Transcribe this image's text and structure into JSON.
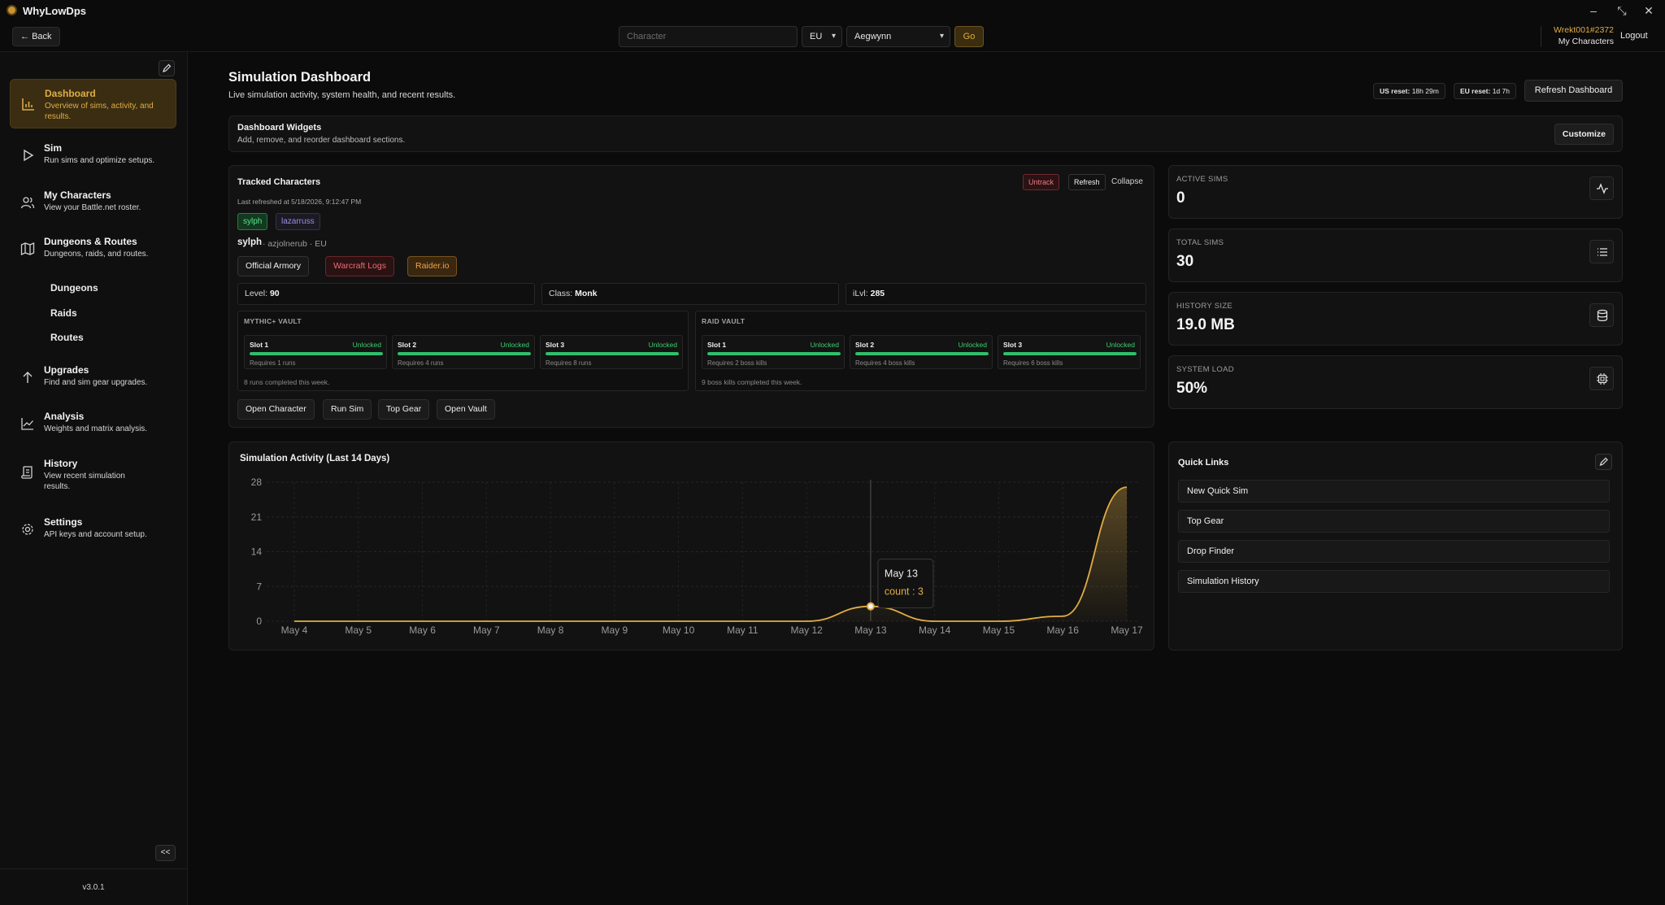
{
  "window": {
    "title": "WhyLowDps"
  },
  "header": {
    "back_label": "Back",
    "character_placeholder": "Character",
    "region": "EU",
    "realm": "Aegwynn",
    "go_label": "Go",
    "user_tag": "Wrekt001#2372",
    "my_characters_label": "My Characters",
    "logout_label": "Logout"
  },
  "sidebar": {
    "items": [
      {
        "title": "Dashboard",
        "desc": "Overview of sims, activity, and results.",
        "icon": "chart-bar-icon"
      },
      {
        "title": "Sim",
        "desc": "Run sims and optimize setups.",
        "icon": "play-icon"
      },
      {
        "title": "My Characters",
        "desc": "View your Battle.net roster.",
        "icon": "users-icon"
      },
      {
        "title": "Dungeons & Routes",
        "desc": "Dungeons, raids, and routes.",
        "icon": "map-icon"
      },
      {
        "title": "Upgrades",
        "desc": "Find and sim gear upgrades.",
        "icon": "arrow-up-icon"
      },
      {
        "title": "Analysis",
        "desc": "Weights and matrix analysis.",
        "icon": "trend-icon"
      },
      {
        "title": "History",
        "desc": "View recent simulation results.",
        "icon": "scroll-icon"
      },
      {
        "title": "Settings",
        "desc": "API keys and account setup.",
        "icon": "gear-icon"
      }
    ],
    "sub_items": [
      "Dungeons",
      "Raids",
      "Routes"
    ],
    "collapse_label": "<<",
    "version": "v3.0.1"
  },
  "page": {
    "title": "Simulation Dashboard",
    "subtitle": "Live simulation activity, system health, and recent results.",
    "us_reset_label": "US reset:",
    "us_reset_value": "18h 29m",
    "eu_reset_label": "EU reset:",
    "eu_reset_value": "1d 7h",
    "refresh_label": "Refresh Dashboard"
  },
  "widgets": {
    "title": "Dashboard Widgets",
    "subtitle": "Add, remove, and reorder dashboard sections.",
    "customize_label": "Customize"
  },
  "tracked": {
    "title": "Tracked Characters",
    "last_refreshed": "Last refreshed at 5/18/2026, 9:12:47 PM",
    "untrack_label": "Untrack",
    "refresh_label": "Refresh",
    "collapse_label": "Collapse",
    "chips": [
      "sylph",
      "lazarruss"
    ],
    "name": "sylph",
    "realm_region": "· azjolnerub · EU",
    "links": [
      "Official Armory",
      "Warcraft Logs",
      "Raider.io"
    ],
    "level_label": "Level:",
    "level": "90",
    "class_label": "Class:",
    "class": "Monk",
    "ilvl_label": "iLvl:",
    "ilvl": "285",
    "mythic_vault": {
      "title": "MYTHIC+ VAULT",
      "slots": [
        {
          "name": "Slot 1",
          "status": "Unlocked",
          "req": "Requires 1 runs",
          "progress": 1
        },
        {
          "name": "Slot 2",
          "status": "Unlocked",
          "req": "Requires 4 runs",
          "progress": 1
        },
        {
          "name": "Slot 3",
          "status": "Unlocked",
          "req": "Requires 8 runs",
          "progress": 1
        }
      ],
      "footer": "8 runs completed this week."
    },
    "raid_vault": {
      "title": "RAID VAULT",
      "slots": [
        {
          "name": "Slot 1",
          "status": "Unlocked",
          "req": "Requires 2 boss kills",
          "progress": 1
        },
        {
          "name": "Slot 2",
          "status": "Unlocked",
          "req": "Requires 4 boss kills",
          "progress": 1
        },
        {
          "name": "Slot 3",
          "status": "Unlocked",
          "req": "Requires 6 boss kills",
          "progress": 1
        }
      ],
      "footer": "9 boss kills completed this week."
    },
    "actions": [
      "Open Character",
      "Run Sim",
      "Top Gear",
      "Open Vault"
    ]
  },
  "stats": [
    {
      "label": "ACTIVE SIMS",
      "value": "0",
      "icon": "activity-icon"
    },
    {
      "label": "TOTAL SIMS",
      "value": "30",
      "icon": "list-icon"
    },
    {
      "label": "HISTORY SIZE",
      "value": "19.0 MB",
      "icon": "database-icon"
    },
    {
      "label": "SYSTEM LOAD",
      "value": "50%",
      "icon": "cpu-icon"
    }
  ],
  "activity": {
    "title": "Simulation Activity (Last 14 Days)",
    "tooltip": {
      "date": "May 13",
      "text": "count : 3"
    }
  },
  "chart_data": {
    "type": "area",
    "title": "Simulation Activity (Last 14 Days)",
    "x": [
      "May 4",
      "May 5",
      "May 6",
      "May 7",
      "May 8",
      "May 9",
      "May 10",
      "May 11",
      "May 12",
      "May 13",
      "May 14",
      "May 15",
      "May 16",
      "May 17"
    ],
    "series": [
      {
        "name": "count",
        "values": [
          0,
          0,
          0,
          0,
          0,
          0,
          0,
          0,
          0,
          3,
          0,
          0,
          1,
          27
        ]
      }
    ],
    "yticks": [
      0,
      7,
      14,
      21,
      28
    ],
    "ylim": [
      0,
      28
    ],
    "grid": true,
    "accent": "#e0ad44"
  },
  "quick_links": {
    "title": "Quick Links",
    "items": [
      "New Quick Sim",
      "Top Gear",
      "Drop Finder",
      "Simulation History"
    ]
  },
  "colors": {
    "accent": "#e0ad44",
    "success": "#3ccf6e",
    "danger": "#f07a7f"
  }
}
